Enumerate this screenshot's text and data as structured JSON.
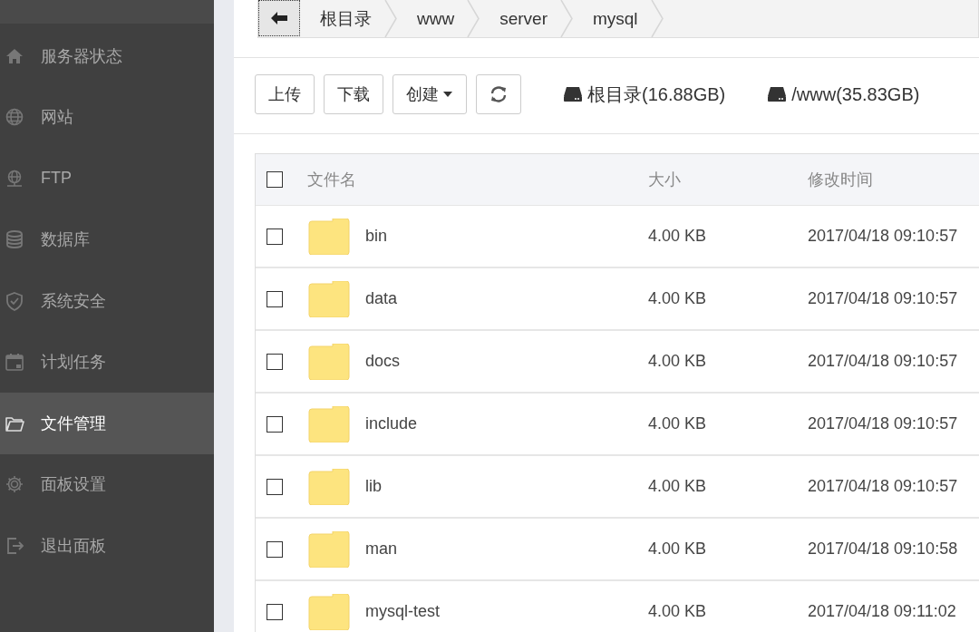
{
  "sidebar": {
    "items": [
      {
        "label": "服务器状态",
        "selected": false
      },
      {
        "label": "网站",
        "selected": false
      },
      {
        "label": "FTP",
        "selected": false
      },
      {
        "label": "数据库",
        "selected": false
      },
      {
        "label": "系统安全",
        "selected": false
      },
      {
        "label": "计划任务",
        "selected": false
      },
      {
        "label": "文件管理",
        "selected": true
      },
      {
        "label": "面板设置",
        "selected": false
      },
      {
        "label": "退出面板",
        "selected": false
      }
    ]
  },
  "breadcrumb": [
    "根目录",
    "www",
    "server",
    "mysql"
  ],
  "toolbar": {
    "buttons": [
      {
        "kind": "plain",
        "label": "上传"
      },
      {
        "kind": "plain",
        "label": "下载"
      },
      {
        "kind": "dropdown",
        "label": "创建"
      },
      {
        "kind": "refresh"
      }
    ],
    "disks": [
      "根目录(16.88GB)",
      "/www(35.83GB)"
    ]
  },
  "table": {
    "columns": [
      "文件名",
      "大小",
      "修改时间"
    ],
    "header_checked": false,
    "rows": [
      {
        "name": "bin",
        "size": "4.00 KB",
        "modified": "2017/04/18 09:10:57",
        "checked": false
      },
      {
        "name": "data",
        "size": "4.00 KB",
        "modified": "2017/04/18 09:10:57",
        "checked": false
      },
      {
        "name": "docs",
        "size": "4.00 KB",
        "modified": "2017/04/18 09:10:57",
        "checked": false
      },
      {
        "name": "include",
        "size": "4.00 KB",
        "modified": "2017/04/18 09:10:57",
        "checked": false
      },
      {
        "name": "lib",
        "size": "4.00 KB",
        "modified": "2017/04/18 09:10:57",
        "checked": false
      },
      {
        "name": "man",
        "size": "4.00 KB",
        "modified": "2017/04/18 09:10:58",
        "checked": false
      },
      {
        "name": "mysql-test",
        "size": "4.00 KB",
        "modified": "2017/04/18 09:11:02",
        "checked": false
      }
    ]
  }
}
